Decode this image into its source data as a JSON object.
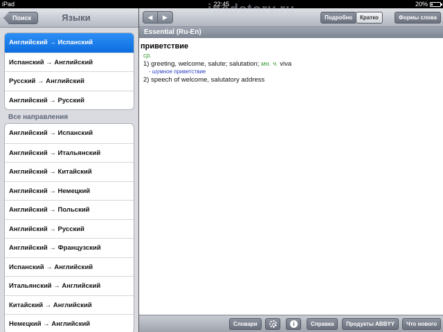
{
  "status_bar": {
    "device": "iPad",
    "time": "22:45",
    "battery": "20%",
    "battery_level": 0.2
  },
  "left_nav": {
    "back_label": "Поиск",
    "title": "Языки"
  },
  "recent_directions": [
    "Английский → Испанский",
    "Испанский → Английский",
    "Русский → Английский",
    "Английский → Русский"
  ],
  "all_section": {
    "title": "Все направления"
  },
  "all_directions": [
    "Английский → Испанский",
    "Английский → Итальянский",
    "Английский → Китайский",
    "Английский → Немецкий",
    "Английский → Польский",
    "Английский → Русский",
    "Английский → Французский",
    "Испанский → Английский",
    "Итальянский → Английский",
    "Китайский → Английский",
    "Немецкий → Английский"
  ],
  "toolbar": {
    "back_arrow": "◀",
    "forward_arrow": "▶",
    "detailed": "Подробно",
    "brief": "Кратко",
    "word_forms": "Формы слова"
  },
  "dictionary": {
    "name": "Essential (Ru-En)",
    "headword": "приветствие",
    "grammar": "ср.",
    "sense1_prefix": "1) greeting, welcome, salute; salutation; ",
    "sense1_note": "мн. ч.",
    "sense1_suffix": " viva",
    "example": "- шумное приветствие",
    "sense2": "2) speech of welcome, salutatory address"
  },
  "bottom_bar": {
    "dictionaries": "Словари",
    "info_glyph": "i",
    "help": "Справка",
    "products": "Продукты ABBYY",
    "whats_new": "Что нового"
  },
  "watermark": "ipadstory.ru"
}
